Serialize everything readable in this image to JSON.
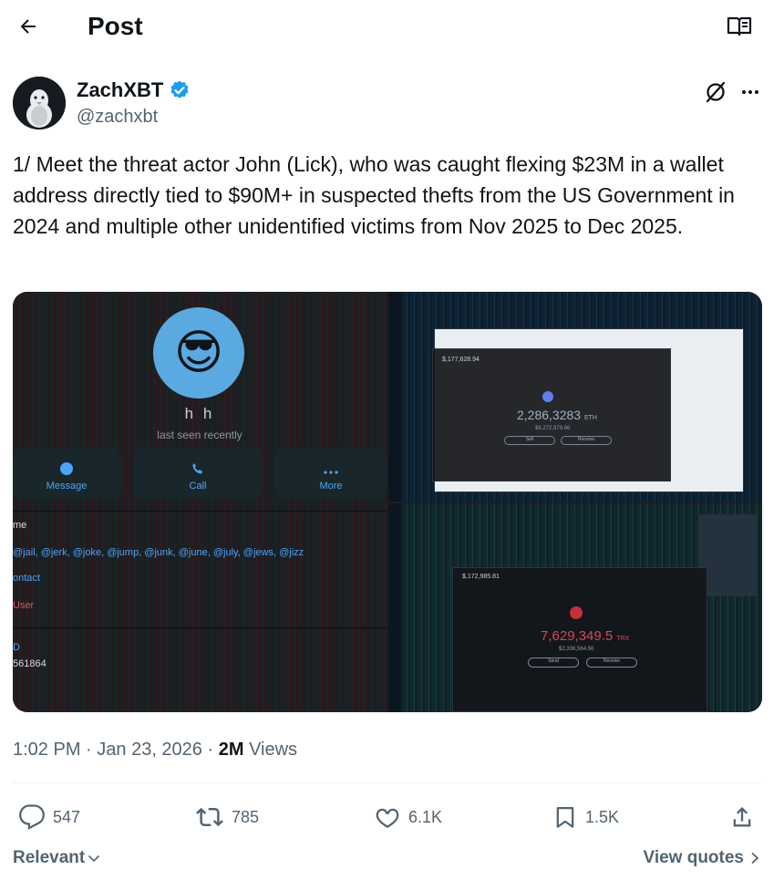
{
  "header": {
    "title": "Post"
  },
  "author": {
    "name": "ZachXBT",
    "handle": "@zachxbt",
    "verified": true
  },
  "post": {
    "text": "1/ Meet the threat actor John (Lick), who was caught flexing $23M in a wallet address directly tied to $90M+  in suspected thefts from the US Government in 2024 and multiple other unidentified victims from Nov 2025 to Dec 2025.",
    "time": "1:02 PM",
    "date": "Jan 23, 2026",
    "views_count": "2M",
    "views_label": "Views"
  },
  "media": {
    "profile": {
      "name": "h h",
      "status": "last seen recently",
      "buttons": [
        "Message",
        "Call",
        "More"
      ],
      "rows": [
        "me",
        "@jail, @jerk, @joke, @jump, @junk, @june, @july, @jews, @jizz",
        "ontact",
        "User",
        "D",
        "561864"
      ]
    },
    "wallet_top": {
      "balance": "2,286,3283",
      "unit": "ETH",
      "sub": "$6,272,879.66",
      "total": "$,177,628.94",
      "buttons": [
        "Sell",
        "Receive"
      ]
    },
    "wallet_bottom": {
      "balance": "7,629,349.5",
      "unit": "TRX",
      "sub": "$2,336,564.56",
      "total": "$,172,985.81",
      "buttons": [
        "Send",
        "Receive"
      ]
    }
  },
  "actions": {
    "replies": "547",
    "reposts": "785",
    "likes": "6.1K",
    "bookmarks": "1.5K"
  },
  "footer": {
    "sort_label": "Relevant",
    "quotes_label": "View quotes"
  },
  "colors": {
    "verified": "#1d9bf0",
    "text": "#0f1419",
    "secondary": "#536471"
  }
}
